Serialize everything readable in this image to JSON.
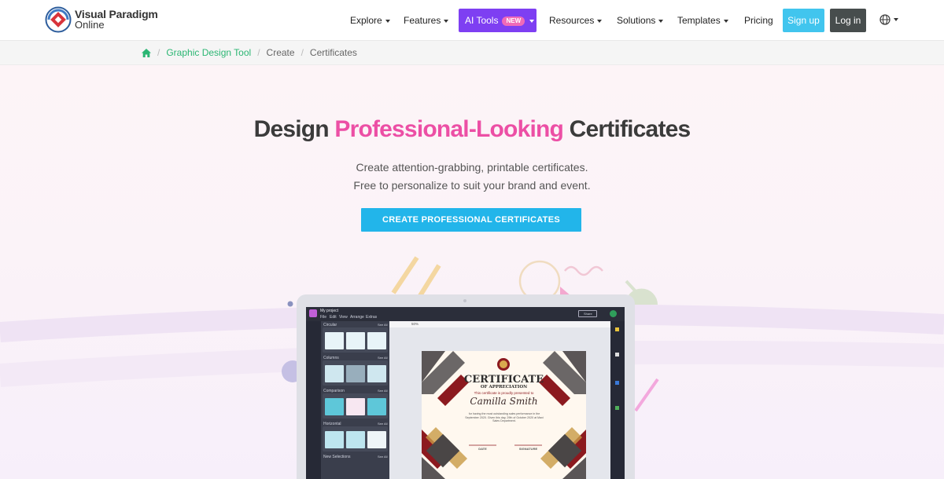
{
  "brand": {
    "line1": "Visual Paradigm",
    "line2": "Online"
  },
  "nav": {
    "explore": "Explore",
    "features": "Features",
    "ai_tools": "AI Tools",
    "ai_badge": "NEW",
    "resources": "Resources",
    "solutions": "Solutions",
    "templates": "Templates",
    "pricing": "Pricing",
    "signup": "Sign up",
    "login": "Log in",
    "language_icon": "globe-icon"
  },
  "breadcrumb": {
    "home_icon": "home-icon",
    "items": [
      "Graphic Design Tool",
      "Create",
      "Certificates"
    ]
  },
  "hero": {
    "title_pre": "Design ",
    "title_highlight": "Professional-Looking",
    "title_post": " Certificates",
    "sub1": "Create attention-grabbing, printable certificates.",
    "sub2": "Free to personalize to suit your brand and event.",
    "cta": "CREATE PROFESSIONAL CERTIFICATES"
  },
  "mockup": {
    "project": "My project",
    "menu": [
      "File",
      "Edit",
      "View",
      "Arrange",
      "Extras"
    ],
    "share": "Share",
    "zoom": "50%",
    "categories": [
      "Circular",
      "Columns",
      "Comparison",
      "Horizontal",
      "New Selections"
    ],
    "see_all": "See All",
    "cert_title": "CERTIFICATE",
    "cert_sub": "OF APPRECIATION",
    "cert_presented": "This certificate is proudly presented to",
    "cert_name": "Camilla Smith",
    "cert_body": "for having the most outstanding sales performance in the September 2020. Given this day, 29th of October 2020 at Maxi Sales Department.",
    "cert_date": "DATE",
    "cert_signature": "SIGNATURE"
  },
  "colors": {
    "accent_pink": "#ec4fa5",
    "ai_purple": "#7e3ff2",
    "cta_blue": "#22b5ea",
    "signup_blue": "#41c5ee",
    "login_dark": "#474d4d",
    "crumb_green": "#2bb673"
  }
}
